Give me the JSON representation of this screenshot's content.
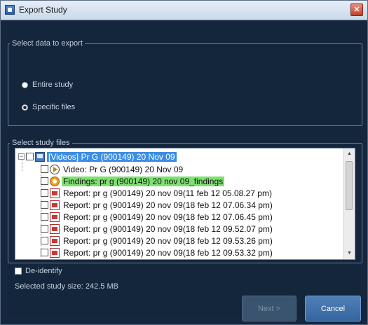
{
  "window": {
    "title": "Export Study",
    "close_glyph": "✕"
  },
  "export_group": {
    "legend": "Select data to export",
    "options": [
      {
        "label": "Entire study",
        "checked": false
      },
      {
        "label": "Specific files",
        "checked": true
      }
    ]
  },
  "files_group": {
    "legend": "Select study files",
    "root": {
      "label": "[Videos] Pr G (900149) 20 Nov 09",
      "expander": "−"
    },
    "items": [
      {
        "label": "Video: Pr G (900149) 20 Nov 09",
        "icon": "video-icon"
      },
      {
        "label": "Findings: pr g (900149) 20 nov 09_findings",
        "icon": "findings-icon"
      },
      {
        "label": "Report: pr g (900149) 20 nov 09(11 feb 12 05.08.27 pm)",
        "icon": "report-icon"
      },
      {
        "label": "Report: pr g (900149) 20 nov 09(18 feb 12 07.06.34 pm)",
        "icon": "report-icon"
      },
      {
        "label": "Report: pr g (900149) 20 nov 09(18 feb 12 07.06.45 pm)",
        "icon": "report-icon"
      },
      {
        "label": "Report: pr g (900149) 20 nov 09(18 feb 12 09.52.07 pm)",
        "icon": "report-icon"
      },
      {
        "label": "Report: pr g (900149) 20 nov 09(18 feb 12 09.53.26 pm)",
        "icon": "report-icon"
      },
      {
        "label": "Report: pr g (900149) 20 nov 09(18 feb 12 09.53.32 pm)",
        "icon": "report-icon"
      }
    ],
    "scroll_up": "▲",
    "scroll_down": "▼"
  },
  "deidentify": {
    "label": "De-identify",
    "checked": false
  },
  "study_size": "Selected study size: 242.5 MB",
  "buttons": {
    "next": "Next >",
    "cancel": "Cancel"
  },
  "colors": {
    "selected": "#3b8de6",
    "highlight": "#7ee070",
    "accent": "#3566a0"
  }
}
